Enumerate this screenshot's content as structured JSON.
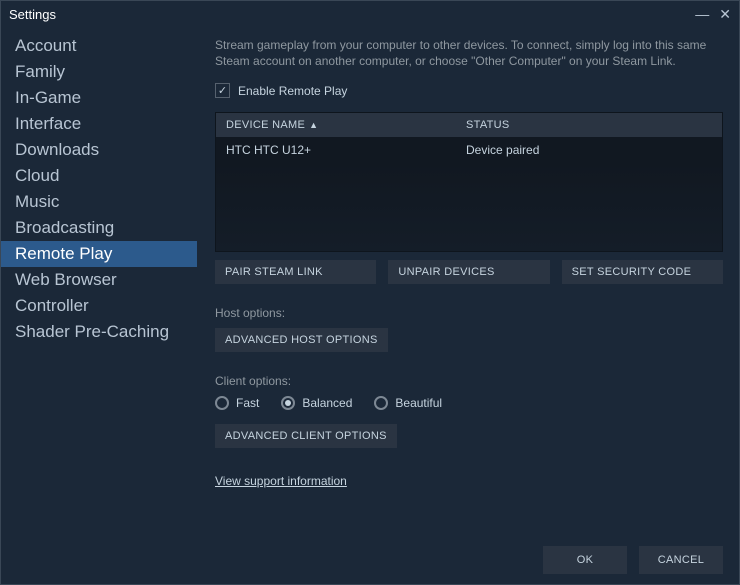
{
  "window": {
    "title": "Settings"
  },
  "sidebar": {
    "items": [
      {
        "label": "Account"
      },
      {
        "label": "Family"
      },
      {
        "label": "In-Game"
      },
      {
        "label": "Interface"
      },
      {
        "label": "Downloads"
      },
      {
        "label": "Cloud"
      },
      {
        "label": "Music"
      },
      {
        "label": "Broadcasting"
      },
      {
        "label": "Remote Play",
        "selected": true
      },
      {
        "label": "Web Browser"
      },
      {
        "label": "Controller"
      },
      {
        "label": "Shader Pre-Caching"
      }
    ]
  },
  "main": {
    "description": "Stream gameplay from your computer to other devices. To connect, simply log into this same Steam account on another computer, or choose \"Other Computer\" on your Steam Link.",
    "enable_label": "Enable Remote Play",
    "table": {
      "col_device": "DEVICE NAME",
      "col_status": "STATUS",
      "rows": [
        {
          "name": "HTC HTC U12+",
          "status": "Device paired"
        }
      ]
    },
    "buttons": {
      "pair": "PAIR STEAM LINK",
      "unpair": "UNPAIR DEVICES",
      "security": "SET SECURITY CODE"
    },
    "host": {
      "label": "Host options:",
      "advanced": "ADVANCED HOST OPTIONS"
    },
    "client": {
      "label": "Client options:",
      "options": {
        "fast": "Fast",
        "balanced": "Balanced",
        "beautiful": "Beautiful"
      },
      "advanced": "ADVANCED CLIENT OPTIONS"
    },
    "support_link": "View support information"
  },
  "footer": {
    "ok": "OK",
    "cancel": "CANCEL"
  }
}
